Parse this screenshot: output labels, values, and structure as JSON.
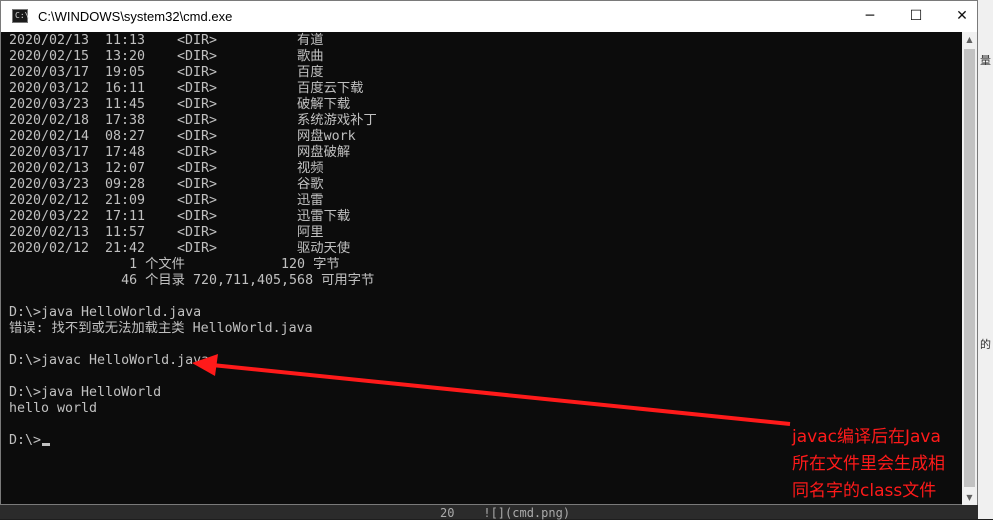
{
  "window": {
    "title": "C:\\WINDOWS\\system32\\cmd.exe",
    "icon_glyph": "C:\\",
    "minimize_glyph": "─",
    "maximize_glyph": "☐",
    "close_glyph": "✕"
  },
  "directory_listing": [
    {
      "date": "2020/02/13",
      "time": "11:13",
      "type": "<DIR>",
      "name": "有道"
    },
    {
      "date": "2020/02/15",
      "time": "13:20",
      "type": "<DIR>",
      "name": "歌曲"
    },
    {
      "date": "2020/03/17",
      "time": "19:05",
      "type": "<DIR>",
      "name": "百度"
    },
    {
      "date": "2020/03/12",
      "time": "16:11",
      "type": "<DIR>",
      "name": "百度云下载"
    },
    {
      "date": "2020/03/23",
      "time": "11:45",
      "type": "<DIR>",
      "name": "破解下载"
    },
    {
      "date": "2020/02/18",
      "time": "17:38",
      "type": "<DIR>",
      "name": "系统游戏补丁"
    },
    {
      "date": "2020/02/14",
      "time": "08:27",
      "type": "<DIR>",
      "name": "网盘work"
    },
    {
      "date": "2020/03/17",
      "time": "17:48",
      "type": "<DIR>",
      "name": "网盘破解"
    },
    {
      "date": "2020/02/13",
      "time": "12:07",
      "type": "<DIR>",
      "name": "视频"
    },
    {
      "date": "2020/03/23",
      "time": "09:28",
      "type": "<DIR>",
      "name": "谷歌"
    },
    {
      "date": "2020/02/12",
      "time": "21:09",
      "type": "<DIR>",
      "name": "迅雷"
    },
    {
      "date": "2020/03/22",
      "time": "17:11",
      "type": "<DIR>",
      "name": "迅雷下载"
    },
    {
      "date": "2020/02/13",
      "time": "11:57",
      "type": "<DIR>",
      "name": "阿里"
    },
    {
      "date": "2020/02/12",
      "time": "21:42",
      "type": "<DIR>",
      "name": "驱动天使"
    }
  ],
  "summary": {
    "files": "               1 个文件            120 字节",
    "dirs": "              46 个目录 720,711,405,568 可用字节"
  },
  "session": [
    "D:\\>java HelloWorld.java",
    "错误: 找不到或无法加载主类 HelloWorld.java",
    "",
    "D:\\>javac HelloWorld.java",
    "",
    "D:\\>java HelloWorld",
    "hello world",
    "",
    "D:\\>"
  ],
  "annotation": {
    "color": "#ff1a1a",
    "lines": [
      "javac编译后在Java",
      "所在文件里会生成相",
      "同名字的class文件"
    ]
  },
  "background": {
    "editor_line": "20    ![](cmd.png)",
    "right_text_1": "量",
    "right_text_2": "的"
  },
  "scrollbar": {
    "up_glyph": "▲",
    "down_glyph": "▼"
  }
}
